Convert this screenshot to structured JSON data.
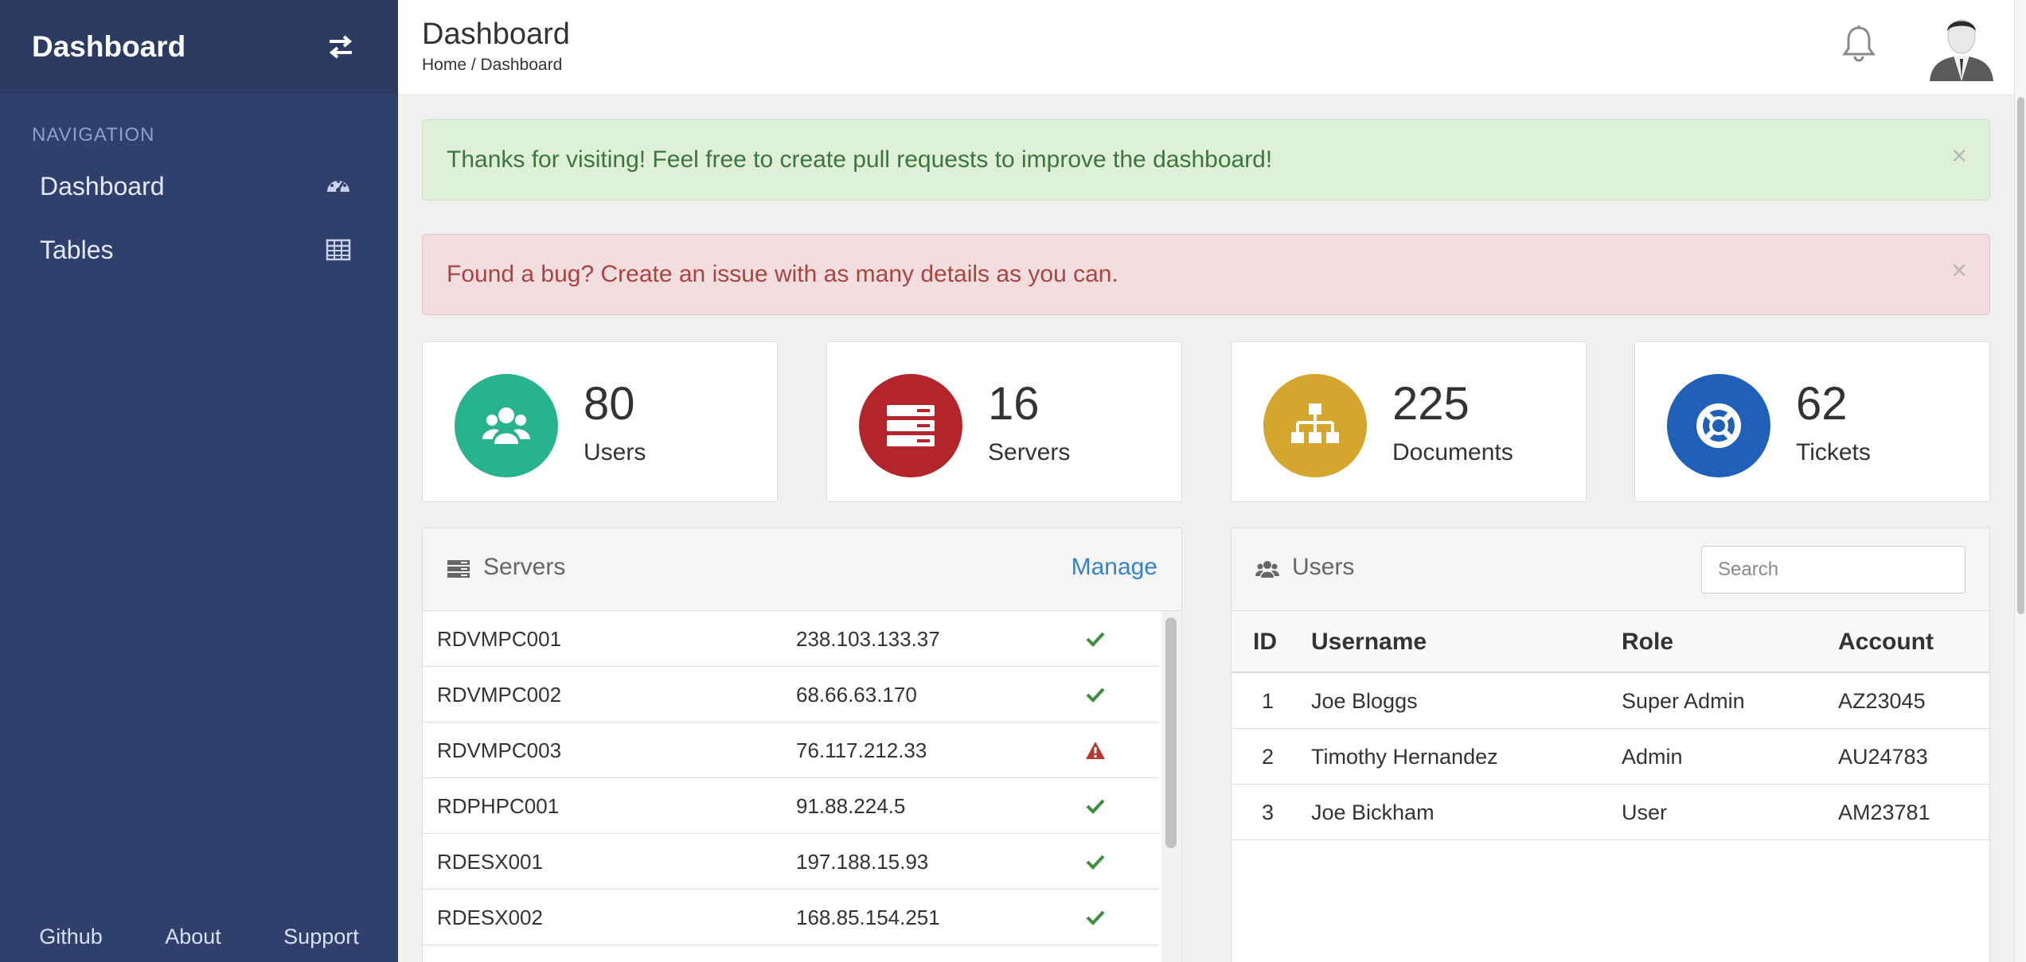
{
  "sidebar": {
    "title": "Dashboard",
    "nav_label": "NAVIGATION",
    "items": [
      {
        "label": "Dashboard",
        "icon": "tachometer-icon"
      },
      {
        "label": "Tables",
        "icon": "table-icon"
      }
    ],
    "footer": [
      "Github",
      "About",
      "Support"
    ]
  },
  "header": {
    "title": "Dashboard",
    "breadcrumb": "Home / Dashboard"
  },
  "alerts": [
    {
      "type": "success",
      "text": "Thanks for visiting! Feel free to create pull requests to improve the dashboard!",
      "close": "×"
    },
    {
      "type": "danger",
      "text": "Found a bug? Create an issue with as many details as you can.",
      "close": "×"
    }
  ],
  "stats": [
    {
      "value": "80",
      "label": "Users",
      "color": "#26b38e",
      "icon": "users-icon"
    },
    {
      "value": "16",
      "label": "Servers",
      "color": "#b3252a",
      "icon": "server-icon"
    },
    {
      "value": "225",
      "label": "Documents",
      "color": "#d4a62e",
      "icon": "sitemap-icon"
    },
    {
      "value": "62",
      "label": "Tickets",
      "color": "#2160b8",
      "icon": "life-ring-icon"
    }
  ],
  "servers_panel": {
    "title": "Servers",
    "manage_label": "Manage",
    "rows": [
      {
        "name": "RDVMPC001",
        "ip": "238.103.133.37",
        "status": "ok"
      },
      {
        "name": "RDVMPC002",
        "ip": "68.66.63.170",
        "status": "ok"
      },
      {
        "name": "RDVMPC003",
        "ip": "76.117.212.33",
        "status": "warning"
      },
      {
        "name": "RDPHPC001",
        "ip": "91.88.224.5",
        "status": "ok"
      },
      {
        "name": "RDESX001",
        "ip": "197.188.15.93",
        "status": "ok"
      },
      {
        "name": "RDESX002",
        "ip": "168.85.154.251",
        "status": "ok"
      }
    ]
  },
  "users_panel": {
    "title": "Users",
    "search_placeholder": "Search",
    "columns": [
      "ID",
      "Username",
      "Role",
      "Account"
    ],
    "rows": [
      {
        "id": "1",
        "username": "Joe Bloggs",
        "role": "Super Admin",
        "account": "AZ23045"
      },
      {
        "id": "2",
        "username": "Timothy Hernandez",
        "role": "Admin",
        "account": "AU24783"
      },
      {
        "id": "3",
        "username": "Joe Bickham",
        "role": "User",
        "account": "AM23781"
      }
    ]
  },
  "colors": {
    "sidebar": "#2f406c",
    "sidebar_header": "#2b3b61",
    "ok": "#3c8d3c",
    "warning": "#b33a32",
    "link": "#3782c4"
  }
}
